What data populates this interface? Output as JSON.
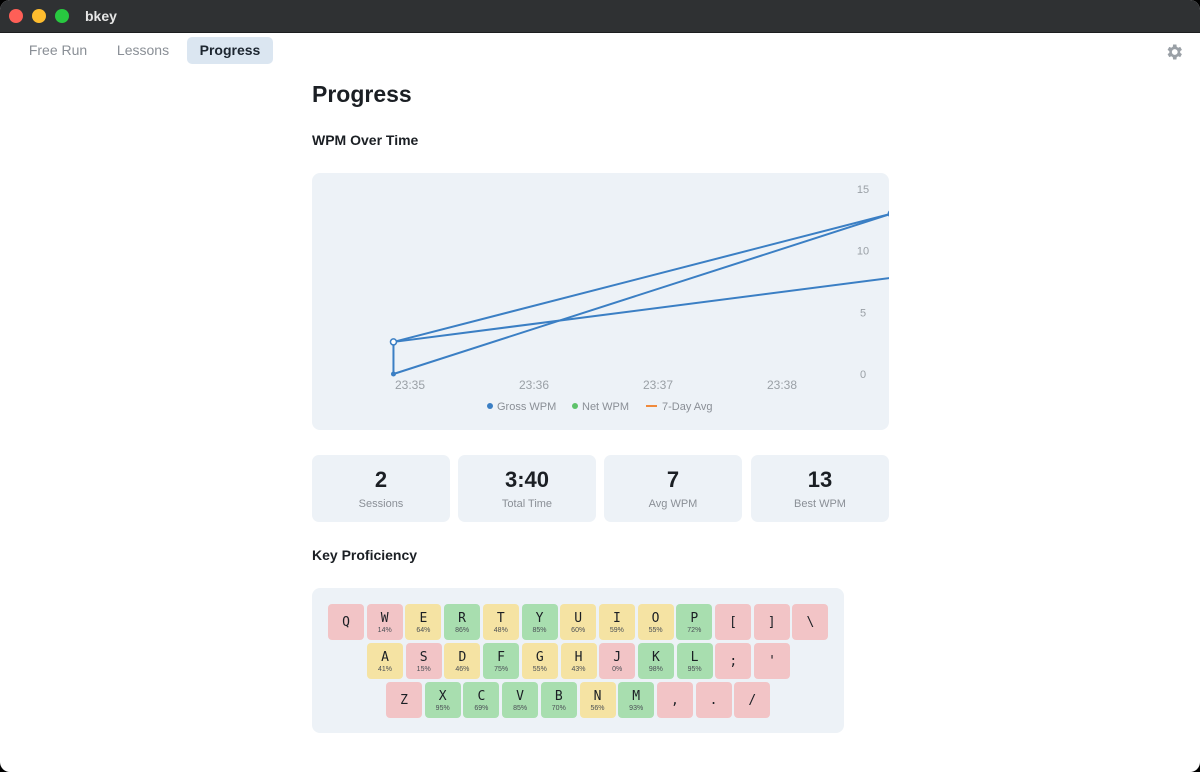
{
  "window": {
    "title": "bkey"
  },
  "tabs": [
    {
      "label": "Free Run",
      "active": false
    },
    {
      "label": "Lessons",
      "active": false
    },
    {
      "label": "Progress",
      "active": true
    }
  ],
  "page": {
    "title": "Progress",
    "chart_section_title": "WPM Over Time",
    "keys_section_title": "Key Proficiency"
  },
  "chart_data": {
    "type": "line",
    "title": "",
    "xlabel": "",
    "ylabel": "",
    "x_ticks": [
      "23:35",
      "23:36",
      "23:37",
      "23:38"
    ],
    "y_ticks": [
      0,
      5,
      10,
      15
    ],
    "ylim": [
      0,
      15
    ],
    "y_axis_side": "right",
    "grid": false,
    "legend_position": "bottom",
    "x": [
      "23:34:52",
      "23:38:53"
    ],
    "series": [
      {
        "name": "Gross WPM",
        "color": "#3b7fc4",
        "values": [
          2.6,
          13
        ]
      },
      {
        "name": "Net WPM",
        "color": "#5ec26a",
        "values": [
          0,
          13
        ]
      },
      {
        "name": "7-Day Avg",
        "color": "#f08a3c",
        "values": [
          2.6,
          7.8
        ]
      }
    ]
  },
  "stats": [
    {
      "value": "2",
      "label": "Sessions"
    },
    {
      "value": "3:40",
      "label": "Total Time"
    },
    {
      "value": "7",
      "label": "Avg WPM"
    },
    {
      "value": "13",
      "label": "Best WPM"
    }
  ],
  "keyboard": {
    "rows": [
      [
        {
          "key": "Q",
          "pct": "",
          "level": "bad"
        },
        {
          "key": "W",
          "pct": "14%",
          "level": "bad"
        },
        {
          "key": "E",
          "pct": "64%",
          "level": "mid"
        },
        {
          "key": "R",
          "pct": "86%",
          "level": "good"
        },
        {
          "key": "T",
          "pct": "48%",
          "level": "mid"
        },
        {
          "key": "Y",
          "pct": "85%",
          "level": "good"
        },
        {
          "key": "U",
          "pct": "60%",
          "level": "mid"
        },
        {
          "key": "I",
          "pct": "59%",
          "level": "mid"
        },
        {
          "key": "O",
          "pct": "55%",
          "level": "mid"
        },
        {
          "key": "P",
          "pct": "72%",
          "level": "good"
        },
        {
          "key": "[",
          "pct": "",
          "level": "bad"
        },
        {
          "key": "]",
          "pct": "",
          "level": "bad"
        },
        {
          "key": "\\",
          "pct": "",
          "level": "bad"
        }
      ],
      [
        {
          "key": "A",
          "pct": "41%",
          "level": "mid"
        },
        {
          "key": "S",
          "pct": "15%",
          "level": "bad"
        },
        {
          "key": "D",
          "pct": "46%",
          "level": "mid"
        },
        {
          "key": "F",
          "pct": "75%",
          "level": "good"
        },
        {
          "key": "G",
          "pct": "55%",
          "level": "mid"
        },
        {
          "key": "H",
          "pct": "43%",
          "level": "mid"
        },
        {
          "key": "J",
          "pct": "0%",
          "level": "bad"
        },
        {
          "key": "K",
          "pct": "98%",
          "level": "good"
        },
        {
          "key": "L",
          "pct": "95%",
          "level": "good"
        },
        {
          "key": ";",
          "pct": "",
          "level": "bad"
        },
        {
          "key": "'",
          "pct": "",
          "level": "bad"
        }
      ],
      [
        {
          "key": "Z",
          "pct": "",
          "level": "bad"
        },
        {
          "key": "X",
          "pct": "95%",
          "level": "good"
        },
        {
          "key": "C",
          "pct": "69%",
          "level": "good"
        },
        {
          "key": "V",
          "pct": "85%",
          "level": "good"
        },
        {
          "key": "B",
          "pct": "70%",
          "level": "good"
        },
        {
          "key": "N",
          "pct": "56%",
          "level": "mid"
        },
        {
          "key": "M",
          "pct": "93%",
          "level": "good"
        },
        {
          "key": ",",
          "pct": "",
          "level": "bad"
        },
        {
          "key": ".",
          "pct": "",
          "level": "bad"
        },
        {
          "key": "/",
          "pct": "",
          "level": "bad"
        }
      ]
    ]
  },
  "icons": {
    "settings": "gear-icon"
  }
}
